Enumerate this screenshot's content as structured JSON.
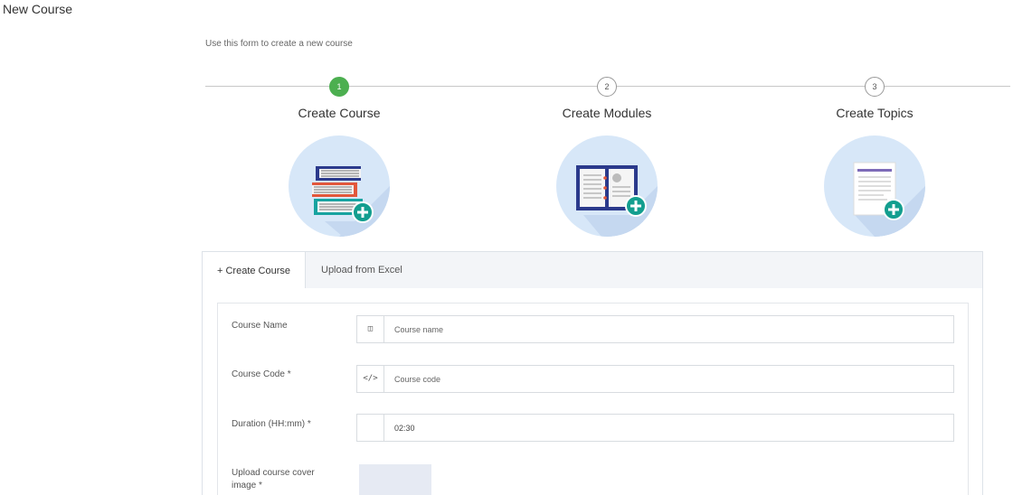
{
  "page": {
    "title": "New Course",
    "subtitle": "Use this form to create a new course"
  },
  "steps": [
    {
      "number": "1",
      "label": "Create Course",
      "icon": "books-plus-icon",
      "active": true
    },
    {
      "number": "2",
      "label": "Create Modules",
      "icon": "open-book-plus-icon",
      "active": false
    },
    {
      "number": "3",
      "label": "Create Topics",
      "icon": "document-plus-icon",
      "active": false
    }
  ],
  "tabs": {
    "create_course": "+ Create Course",
    "upload_excel": "Upload from Excel"
  },
  "form": {
    "course_name": {
      "label": "Course Name",
      "addon": "◫",
      "placeholder": "Course name",
      "value": ""
    },
    "course_code": {
      "label": "Course Code *",
      "addon": "</>",
      "placeholder": "Course code",
      "value": ""
    },
    "duration": {
      "label": "Duration (HH:mm) *",
      "addon": "",
      "placeholder": "",
      "value": "02:30"
    },
    "cover_image": {
      "label": "Upload course cover image *"
    }
  },
  "colors": {
    "step_active": "#4caf50",
    "illustration_bg": "#d7e7f8",
    "plus_badge": "#139e8f"
  }
}
